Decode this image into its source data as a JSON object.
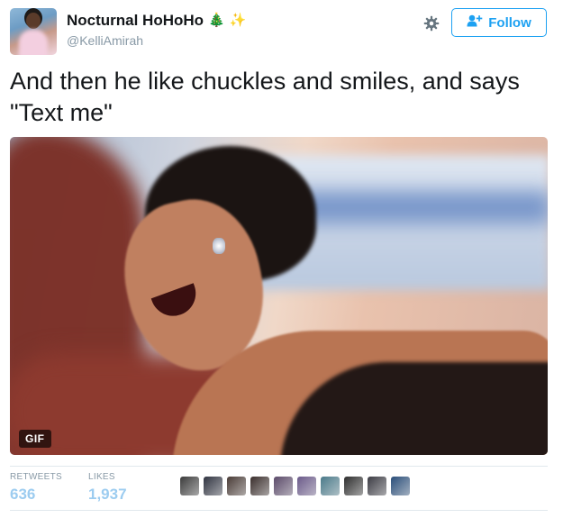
{
  "user": {
    "display_name": "Nocturnal HoHoHo",
    "handle": "@KelliAmirah",
    "name_emojis": [
      "🎄",
      "✨"
    ]
  },
  "actions": {
    "follow_label": "Follow",
    "icons": [
      "gear-icon",
      "follow-person-plus-icon"
    ]
  },
  "tweet": {
    "text": "And then he like chuckles and smiles, and says \"Text me\""
  },
  "media": {
    "badge": "GIF"
  },
  "stats": {
    "retweets_label": "RETWEETS",
    "retweets_value": "636",
    "likes_label": "LIKES",
    "likes_value": "1,937"
  },
  "likers": {
    "count": 10,
    "colors": [
      "#3b3b3b",
      "#2f3340",
      "#4a3c37",
      "#3a2e2c",
      "#5b4a6a",
      "#6b5a8a",
      "#4a7a8a",
      "#2e2e2e",
      "#3c3c44",
      "#2a4e7a"
    ]
  },
  "colors": {
    "accent": "#1da1f2",
    "stat_value": "#9cccf0",
    "muted": "#8899a6"
  }
}
